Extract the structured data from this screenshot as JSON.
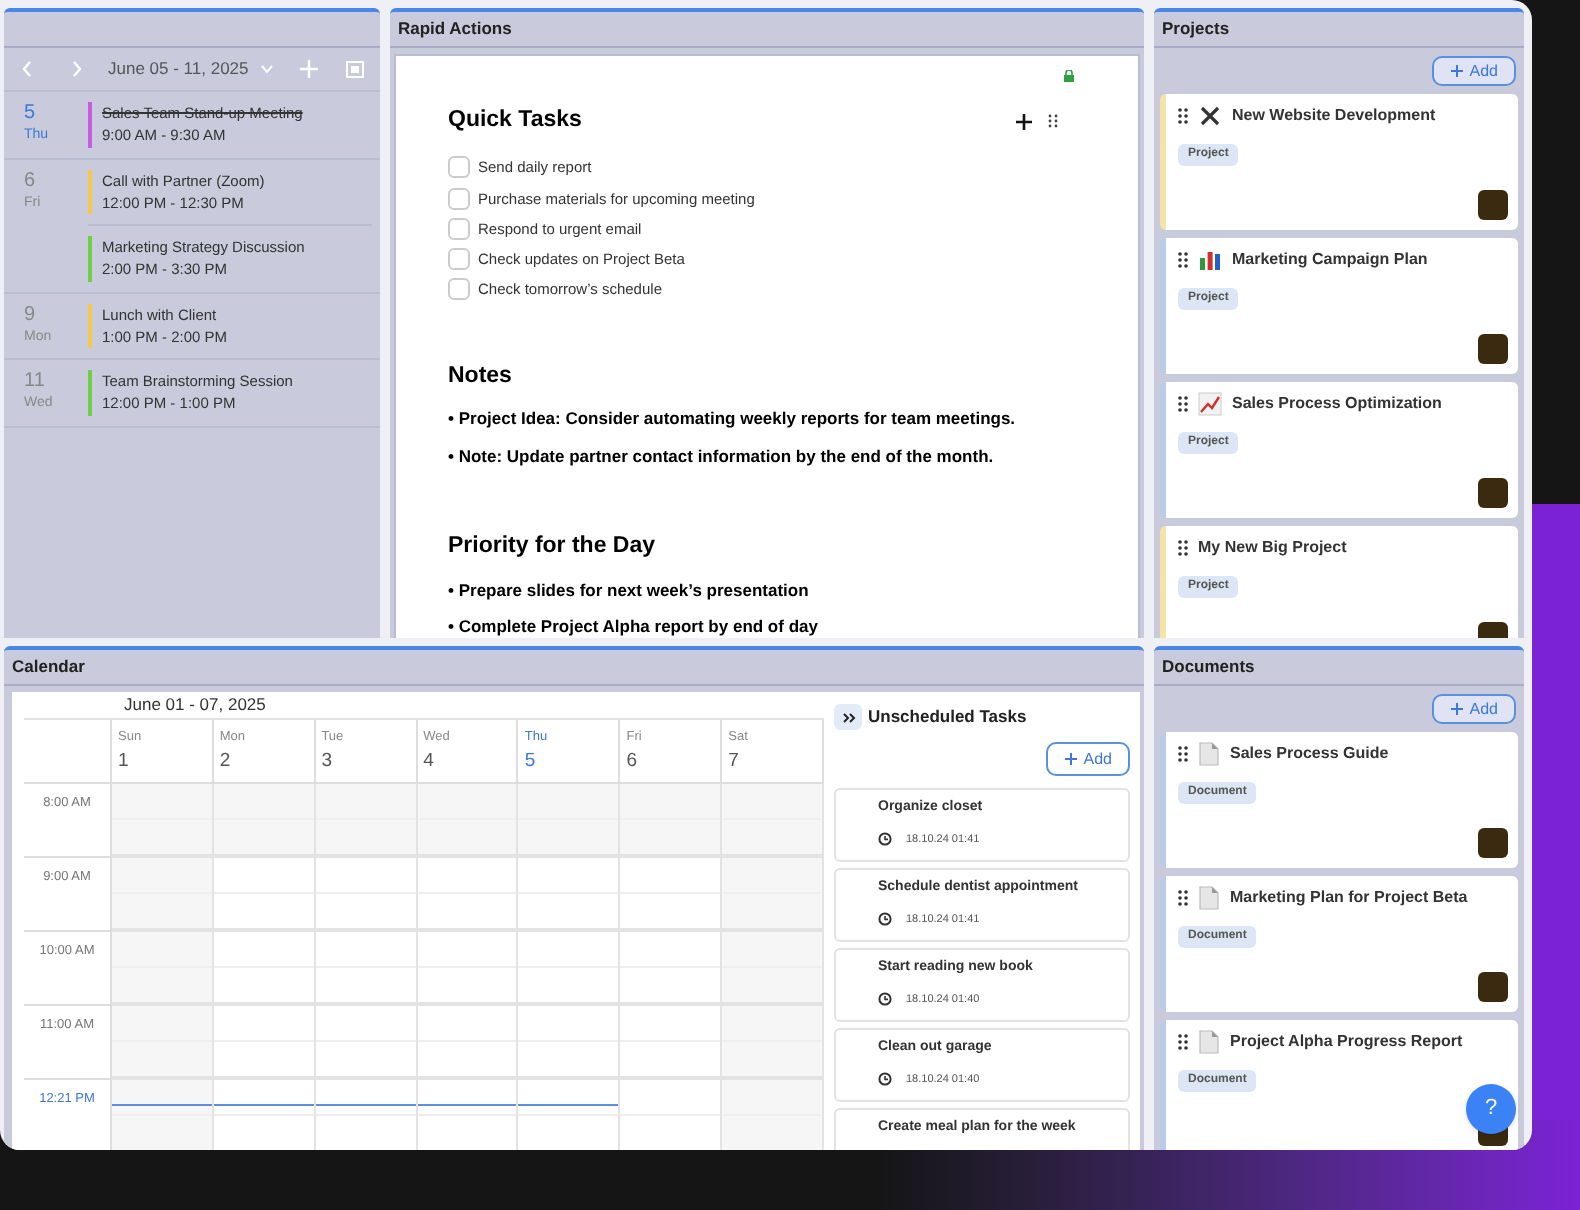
{
  "agenda": {
    "range": "June 05 - 11, 2025",
    "days": [
      {
        "day": "5",
        "weekday": "Thu",
        "selected": true,
        "events": [
          {
            "title": "Sales Team Stand-up Meeting",
            "time": "9:00 AM - 9:30 AM",
            "color": "#c35ee0",
            "done": true
          }
        ]
      },
      {
        "day": "6",
        "weekday": "Fri",
        "selected": false,
        "events": [
          {
            "title": "Call with Partner (Zoom)",
            "time": "12:00 PM - 12:30 PM",
            "color": "#f2c94c",
            "done": false
          },
          {
            "title": "Marketing Strategy Discussion",
            "time": "2:00 PM - 3:30 PM",
            "color": "#6fcf45",
            "done": false
          }
        ]
      },
      {
        "day": "9",
        "weekday": "Mon",
        "selected": false,
        "events": [
          {
            "title": "Lunch with Client",
            "time": "1:00 PM - 2:00 PM",
            "color": "#f2c94c",
            "done": false
          }
        ]
      },
      {
        "day": "11",
        "weekday": "Wed",
        "selected": false,
        "events": [
          {
            "title": "Team Brainstorming Session",
            "time": "12:00 PM - 1:00 PM",
            "color": "#6fcf45",
            "done": false
          }
        ]
      }
    ]
  },
  "rapid_actions": {
    "title": "Rapid Actions",
    "quick_tasks": {
      "heading": "Quick Tasks",
      "items": [
        {
          "label": "Send daily report",
          "checked": false
        },
        {
          "label": "Purchase materials for upcoming meeting",
          "checked": false
        },
        {
          "label": "Respond to urgent email",
          "checked": false
        },
        {
          "label": "Check updates on Project Beta",
          "checked": false
        },
        {
          "label": "Check tomorrow’s schedule",
          "checked": false
        }
      ]
    },
    "notes": {
      "heading": "Notes",
      "items": [
        "• Project Idea: Consider automating weekly reports for team meetings.",
        "• Note: Update partner contact information by the end of the month."
      ]
    },
    "priority": {
      "heading": "Priority for the Day",
      "items": [
        "• Prepare slides for next week’s presentation",
        "• Complete Project Alpha report by end of day"
      ]
    }
  },
  "projects": {
    "title": "Projects",
    "add_label": "Add",
    "items": [
      {
        "title": "New Website Development",
        "tag": "Project",
        "kind": "tools",
        "color": "#f5e3a8"
      },
      {
        "title": "Marketing Campaign Plan",
        "tag": "Project",
        "kind": "bar-chart",
        "color": "#b9cbe6"
      },
      {
        "title": "Sales Process Optimization",
        "tag": "Project",
        "kind": "line-chart",
        "color": "#b9cbe6"
      },
      {
        "title": "My New Big Project",
        "tag": "Project",
        "color": "#f5e3a8"
      }
    ]
  },
  "calendar": {
    "title": "Calendar",
    "range": "June 01 - 07, 2025",
    "days": [
      {
        "weekday": "Sun",
        "day": "1",
        "selected": false
      },
      {
        "weekday": "Mon",
        "day": "2",
        "selected": false
      },
      {
        "weekday": "Tue",
        "day": "3",
        "selected": false
      },
      {
        "weekday": "Wed",
        "day": "4",
        "selected": false
      },
      {
        "weekday": "Thu",
        "day": "5",
        "selected": true
      },
      {
        "weekday": "Fri",
        "day": "6",
        "selected": false
      },
      {
        "weekday": "Sat",
        "day": "7",
        "selected": false
      }
    ],
    "times": [
      {
        "label": "8:00 AM",
        "current": false
      },
      {
        "label": "9:00 AM",
        "current": false
      },
      {
        "label": "10:00 AM",
        "current": false
      },
      {
        "label": "11:00 AM",
        "current": false
      },
      {
        "label": "12:21 PM",
        "current": true
      }
    ]
  },
  "unscheduled": {
    "title": "Unscheduled Tasks",
    "add_label": "Add",
    "items": [
      {
        "title": "Organize closet",
        "time": "18.10.24 01:41"
      },
      {
        "title": "Schedule dentist appointment",
        "time": "18.10.24 01:41"
      },
      {
        "title": "Start reading new book",
        "time": "18.10.24 01:40"
      },
      {
        "title": "Clean out garage",
        "time": "18.10.24 01:40"
      },
      {
        "title": "Create meal plan for the week"
      }
    ]
  },
  "documents": {
    "title": "Documents",
    "add_label": "Add",
    "items": [
      {
        "title": "Sales Process Guide",
        "tag": "Document",
        "color": "#b9cbe6"
      },
      {
        "title": "Marketing Plan for Project Beta",
        "tag": "Document",
        "color": "#b9cbe6"
      },
      {
        "title": "Project Alpha Progress Report",
        "tag": "Document",
        "color": "#b9cbe6"
      }
    ]
  },
  "help_button": "?"
}
